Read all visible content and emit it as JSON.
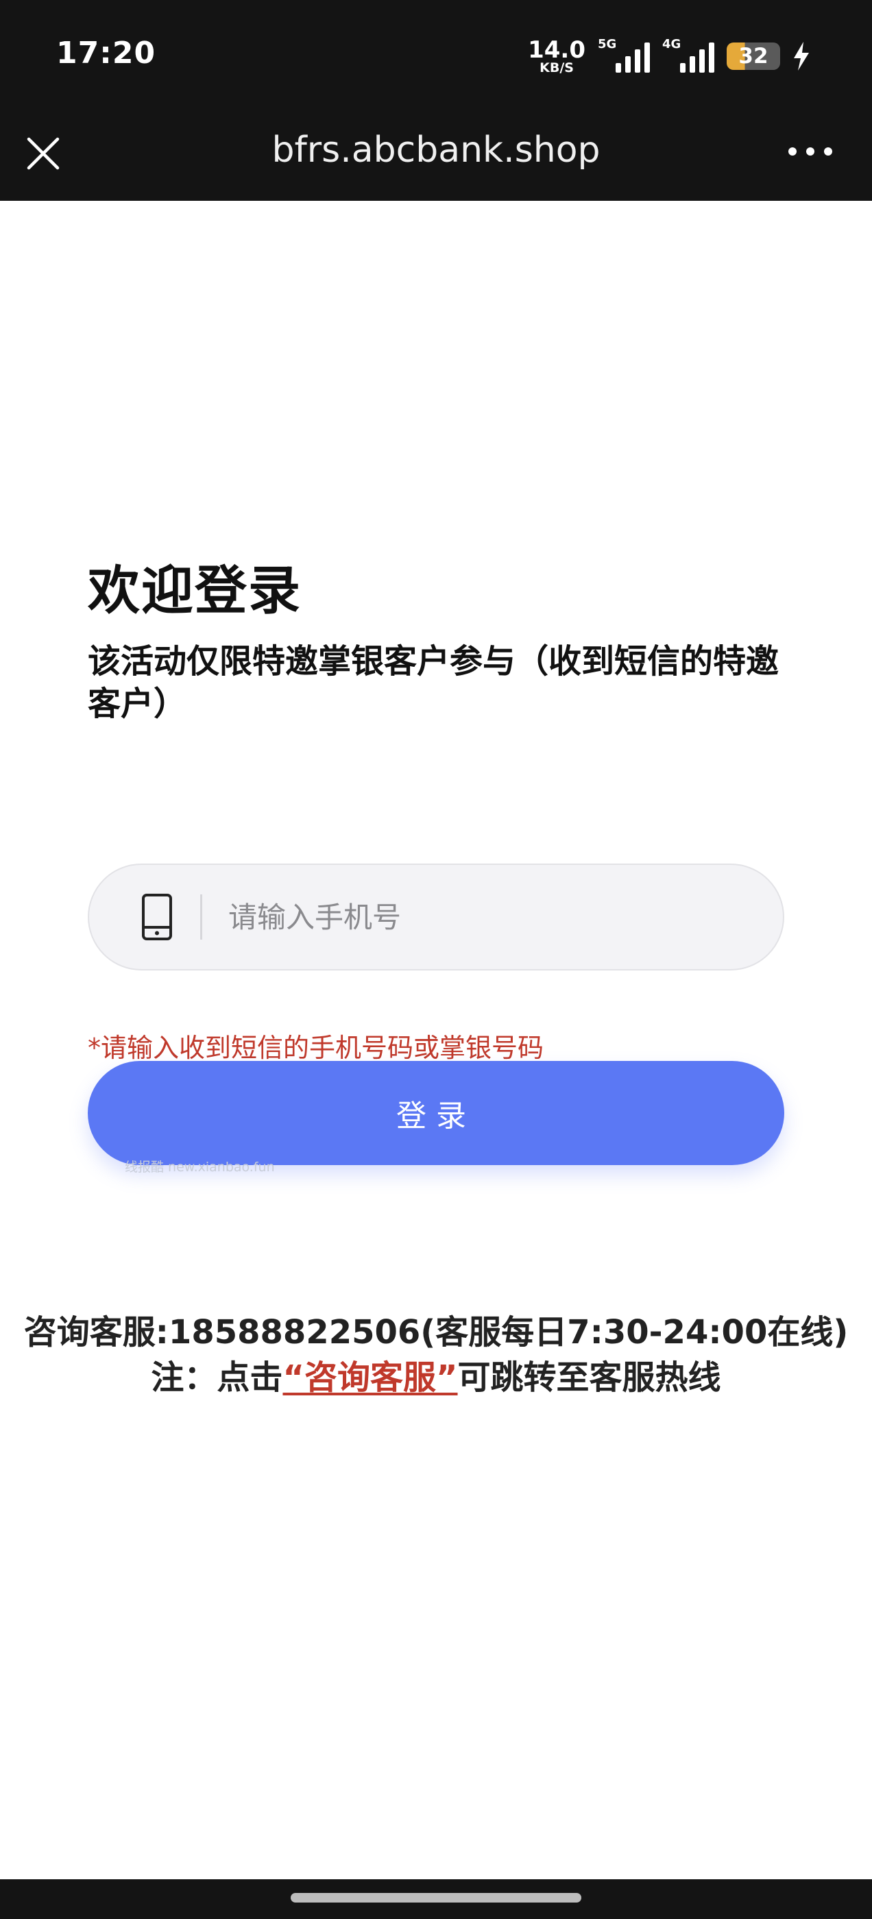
{
  "status_bar": {
    "time": "17:20",
    "speed_value": "14.0",
    "speed_unit": "KB/S",
    "sim1_tag": "5G",
    "sim2_tag": "4G",
    "battery_level": "32"
  },
  "browser": {
    "url": "bfrs.abcbank.shop"
  },
  "login": {
    "title": "欢迎登录",
    "subtitle": "该活动仅限特邀掌银客户参与（收到短信的特邀客户）",
    "phone_placeholder": "请输入手机号",
    "hint": "*请输入收到短信的手机号码或掌银号码",
    "button_label": "登录",
    "watermark": "线报酷 new.xianbao.fun"
  },
  "service": {
    "line": "咨询客服:18588822506(客服每日7:30-24:00在线)",
    "note_prefix": "注：点击",
    "note_link": "“咨询客服”",
    "note_suffix": "可跳转至客服热线"
  },
  "colors": {
    "accent": "#5b78f4",
    "warning": "#c0392b",
    "bar": "#141414"
  }
}
